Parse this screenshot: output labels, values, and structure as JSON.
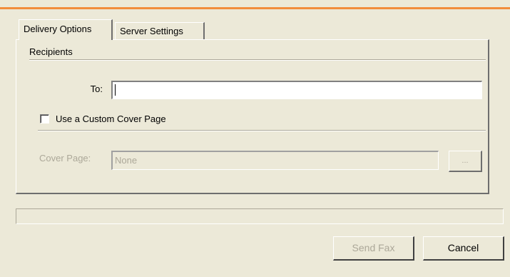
{
  "tabs": [
    {
      "label": "Delivery Options",
      "active": true
    },
    {
      "label": "Server Settings",
      "active": false
    }
  ],
  "recipients": {
    "section_label": "Recipients",
    "to_label": "To:",
    "to_value": ""
  },
  "cover": {
    "checkbox_label": "Use a Custom Cover Page",
    "checked": false,
    "cover_label": "Cover Page:",
    "cover_value": "None",
    "browse_label": "..."
  },
  "buttons": {
    "send": "Send Fax",
    "cancel": "Cancel"
  },
  "colors": {
    "accent": "#f28d3c",
    "background": "#ece9d8",
    "disabled_text": "#aca899"
  }
}
